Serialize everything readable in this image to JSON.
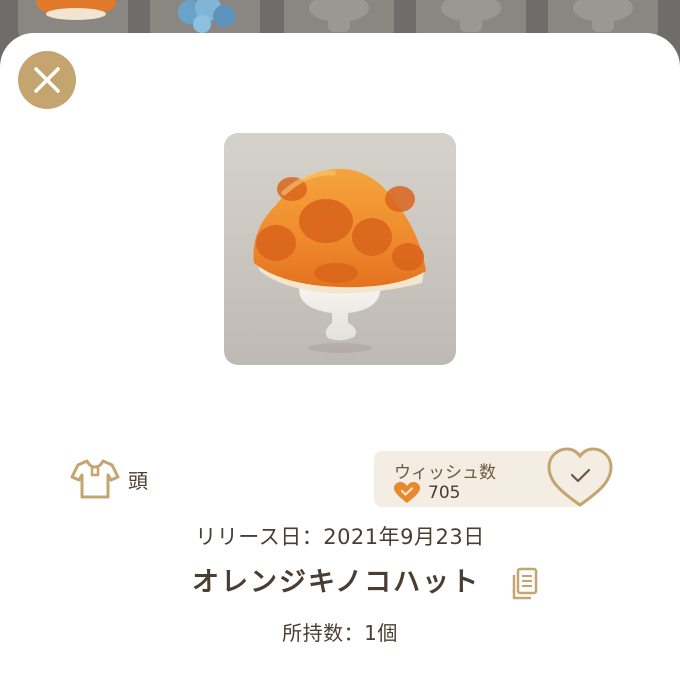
{
  "header": {
    "close_icon": "close-icon"
  },
  "item": {
    "image_icon": "orange-mushroom-hat-image",
    "category_icon": "shirt-icon",
    "category": "頭",
    "release_label": "リリース日：",
    "release_date": "2021年9月23日",
    "name": "オレンジキノコハット",
    "copy_icon": "copy-icon",
    "owned_label": "所持数：",
    "owned_count": "1個"
  },
  "wish": {
    "title": "ウィッシュ数",
    "count": "705",
    "count_icon": "heart-check-icon",
    "button_icon": "heart-check-outline-icon"
  },
  "colors": {
    "accent_gold": "#c4a56f",
    "wish_orange": "#e8892f",
    "text_brown": "#4a3e33",
    "wish_bg": "#f3ede3"
  }
}
